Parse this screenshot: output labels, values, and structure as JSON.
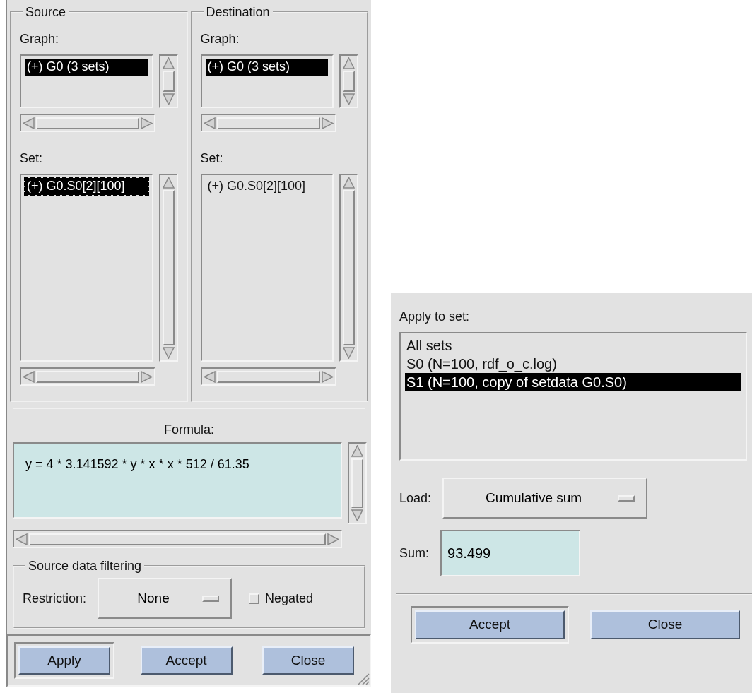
{
  "left_dialog": {
    "panels": [
      {
        "title": "Source",
        "graph_label": "Graph:",
        "graphs": [
          {
            "label": "(+) G0 (3 sets)",
            "selected": true,
            "focused": false
          }
        ],
        "set_label": "Set:",
        "sets": [
          {
            "label": "(+) G0.S0[2][100]",
            "selected": true,
            "focused": true
          }
        ]
      },
      {
        "title": "Destination",
        "graph_label": "Graph:",
        "graphs": [
          {
            "label": "(+) G0 (3 sets)",
            "selected": true,
            "focused": false
          }
        ],
        "set_label": "Set:",
        "sets": [
          {
            "label": "(+) G0.S0[2][100]",
            "selected": false,
            "focused": false
          }
        ]
      }
    ],
    "formula": {
      "label": "Formula:",
      "value": "y = 4 * 3.141592 * y * x * x * 512 / 61.35"
    },
    "filtering": {
      "title": "Source data filtering",
      "restriction_label": "Restriction:",
      "restriction": "None",
      "negated": {
        "label": "Negated",
        "checked": false
      }
    },
    "buttons": [
      {
        "label": "Apply",
        "default": true
      },
      {
        "label": "Accept",
        "default": false
      },
      {
        "label": "Close",
        "default": false
      }
    ]
  },
  "right_dialog": {
    "apply_label": "Apply to set:",
    "sets": [
      {
        "label": "All sets",
        "selected": false
      },
      {
        "label": "S0 (N=100, rdf_o_c.log)",
        "selected": false
      },
      {
        "label": "S1 (N=100, copy of setdata G0.S0)",
        "selected": true
      }
    ],
    "load_label": "Load:",
    "load": "Cumulative sum",
    "sum_label": "Sum:",
    "sum": "93.499",
    "buttons": [
      {
        "label": "Accept",
        "default": true
      },
      {
        "label": "Close",
        "default": false
      }
    ]
  }
}
